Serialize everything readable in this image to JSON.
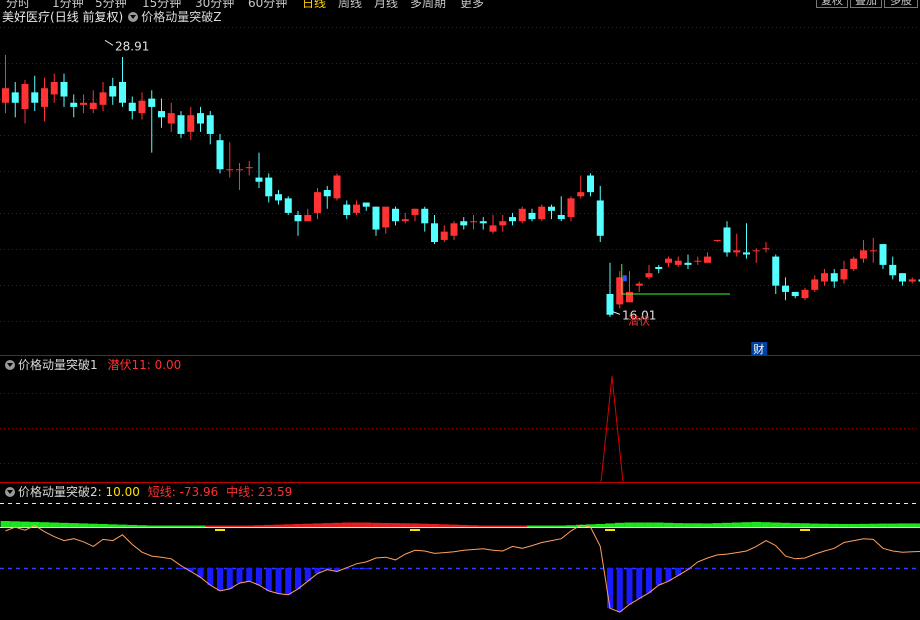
{
  "toolbar": {
    "periods": [
      "分时",
      "1分钟",
      "5分钟",
      "15分钟",
      "30分钟",
      "60分钟",
      "日线",
      "周线",
      "月线",
      "多周期",
      "更多"
    ],
    "active_period": "日线",
    "buttons": [
      "复权",
      "叠加",
      "多股"
    ]
  },
  "main_panel": {
    "symbol": "美好医疗",
    "mode": "(日线 前复权)",
    "indicator": "价格动量突破Z",
    "high_label": "28.91",
    "low_label": "16.01",
    "low_annotation": "潜伏",
    "fin_marker": "财"
  },
  "panel2": {
    "indicator": "价格动量突破1",
    "value_label": "潜伏11: 0.00"
  },
  "panel3": {
    "indicator": "价格动量突破2",
    "value_label": ": 10.00",
    "short_label": "短线: -73.96",
    "mid_label": "中线: 23.59"
  },
  "colors": {
    "up": "#ff3333",
    "down": "#54ffff",
    "grid": "#8b0000",
    "line_green": "#33ff33",
    "ma_orange": "#ffa060",
    "spike_red": "#dd0000",
    "bar_blue": "#1a1aff"
  },
  "chart_data": [
    {
      "type": "candlestick",
      "candles": [
        [
          26.0,
          26.7,
          25.5,
          28.3
        ],
        [
          26.5,
          26.0,
          25.3,
          27.0
        ],
        [
          25.7,
          26.9,
          25.0,
          27.1
        ],
        [
          26.5,
          26.0,
          25.6,
          27.3
        ],
        [
          25.8,
          26.7,
          25.1,
          27.2
        ],
        [
          26.4,
          27.0,
          26.0,
          27.4
        ],
        [
          27.0,
          26.3,
          25.8,
          27.4
        ],
        [
          26.0,
          25.8,
          25.3,
          26.4
        ],
        [
          25.9,
          26.0,
          25.5,
          26.4
        ],
        [
          25.7,
          26.0,
          25.5,
          26.6
        ],
        [
          25.9,
          26.5,
          25.6,
          27.0
        ],
        [
          26.8,
          26.3,
          25.9,
          27.2
        ],
        [
          27.0,
          26.0,
          25.8,
          28.2
        ],
        [
          26.0,
          25.6,
          25.2,
          26.3
        ],
        [
          25.5,
          26.1,
          25.2,
          26.5
        ],
        [
          26.2,
          25.8,
          23.6,
          26.6
        ],
        [
          25.6,
          25.3,
          24.8,
          26.2
        ],
        [
          25.0,
          25.5,
          24.6,
          26.0
        ],
        [
          25.4,
          24.5,
          24.3,
          25.6
        ],
        [
          24.6,
          25.4,
          24.2,
          25.8
        ],
        [
          25.5,
          25.0,
          24.6,
          25.8
        ],
        [
          25.4,
          24.5,
          24.0,
          25.6
        ],
        [
          24.2,
          22.8,
          22.6,
          24.5
        ],
        [
          22.8,
          22.8,
          22.4,
          24.1
        ],
        [
          22.8,
          22.8,
          21.8,
          23.1
        ],
        [
          22.9,
          22.9,
          22.5,
          23.2
        ],
        [
          22.4,
          22.2,
          21.9,
          23.6
        ],
        [
          22.4,
          21.5,
          21.2,
          22.6
        ],
        [
          21.6,
          21.3,
          21.1,
          21.8
        ],
        [
          21.4,
          20.7,
          20.6,
          21.5
        ],
        [
          20.6,
          20.3,
          19.6,
          20.8
        ],
        [
          20.3,
          20.6,
          20.3,
          20.9
        ],
        [
          20.7,
          21.7,
          20.4,
          21.9
        ],
        [
          21.8,
          21.5,
          20.9,
          22.0
        ],
        [
          21.4,
          22.5,
          21.3,
          22.6
        ],
        [
          21.1,
          20.6,
          20.4,
          21.3
        ],
        [
          20.7,
          21.1,
          20.6,
          21.3
        ],
        [
          21.2,
          21.0,
          20.8,
          21.2
        ],
        [
          21.0,
          19.9,
          19.6,
          21.0
        ],
        [
          20.0,
          21.0,
          19.7,
          21.0
        ],
        [
          20.9,
          20.3,
          20.1,
          21.0
        ],
        [
          20.3,
          20.4,
          20.2,
          20.7
        ],
        [
          20.6,
          20.9,
          20.3,
          20.9
        ],
        [
          20.9,
          20.2,
          19.8,
          21.0
        ],
        [
          20.2,
          19.3,
          19.2,
          20.6
        ],
        [
          19.4,
          19.8,
          19.3,
          20.1
        ],
        [
          19.6,
          20.2,
          19.4,
          20.3
        ],
        [
          20.3,
          20.1,
          19.9,
          20.5
        ],
        [
          20.3,
          20.3,
          19.9,
          20.6
        ],
        [
          20.3,
          20.2,
          19.9,
          20.5
        ],
        [
          19.8,
          20.1,
          19.7,
          20.6
        ],
        [
          20.1,
          20.3,
          19.8,
          20.6
        ],
        [
          20.5,
          20.3,
          20.1,
          20.7
        ],
        [
          20.3,
          20.9,
          20.2,
          21.0
        ],
        [
          20.7,
          20.4,
          20.3,
          20.9
        ],
        [
          20.4,
          21.0,
          20.3,
          21.1
        ],
        [
          21.0,
          20.8,
          20.4,
          21.1
        ],
        [
          20.6,
          20.4,
          20.3,
          21.5
        ],
        [
          20.5,
          21.4,
          20.3,
          21.5
        ],
        [
          21.5,
          21.7,
          21.4,
          22.5
        ],
        [
          22.5,
          21.7,
          21.5,
          22.6
        ],
        [
          21.3,
          19.6,
          19.3,
          22.0
        ],
        [
          16.8,
          15.8,
          15.7,
          18.3
        ],
        [
          16.3,
          17.6,
          16.1,
          17.9
        ],
        [
          16.4,
          16.9,
          16.5,
          17.9
        ],
        [
          17.2,
          17.3,
          16.9,
          17.4
        ],
        [
          17.6,
          17.8,
          17.5,
          18.2
        ],
        [
          18.1,
          18.0,
          17.8,
          18.2
        ],
        [
          18.3,
          18.5,
          18.1,
          18.6
        ],
        [
          18.2,
          18.4,
          18.1,
          18.6
        ],
        [
          18.3,
          18.2,
          18.0,
          18.7
        ],
        [
          18.4,
          18.4,
          18.2,
          18.6
        ],
        [
          18.3,
          18.6,
          18.3,
          18.8
        ],
        [
          19.4,
          19.4,
          19.3,
          19.4
        ],
        [
          20.0,
          18.8,
          18.6,
          20.3
        ],
        [
          18.8,
          18.9,
          18.6,
          19.7
        ],
        [
          18.8,
          18.7,
          18.5,
          20.2
        ],
        [
          18.9,
          18.9,
          18.3,
          19.0
        ],
        [
          19.0,
          19.0,
          18.8,
          19.3
        ],
        [
          18.6,
          17.2,
          16.8,
          18.7
        ],
        [
          17.2,
          16.9,
          16.5,
          17.6
        ],
        [
          16.9,
          16.7,
          16.6,
          16.9
        ],
        [
          16.6,
          17.0,
          16.5,
          17.1
        ],
        [
          17.0,
          17.5,
          16.9,
          17.7
        ],
        [
          17.4,
          17.8,
          17.2,
          18.0
        ],
        [
          17.8,
          17.4,
          17.1,
          18.0
        ],
        [
          17.5,
          18.0,
          17.3,
          18.4
        ],
        [
          18.0,
          18.5,
          17.9,
          18.6
        ],
        [
          18.5,
          18.9,
          18.3,
          19.4
        ],
        [
          18.9,
          18.9,
          18.3,
          19.5
        ],
        [
          19.2,
          18.2,
          18.0,
          19.2
        ],
        [
          18.2,
          17.7,
          17.5,
          18.6
        ],
        [
          17.8,
          17.4,
          17.2,
          17.8
        ],
        [
          17.4,
          17.5,
          17.3,
          17.6
        ],
        [
          17.5,
          17.4,
          17.2,
          17.6
        ],
        [
          17.4,
          17.5,
          17.3,
          17.7
        ]
      ],
      "y_range": [
        15.5,
        29.5
      ],
      "high_marker": 28.91,
      "low_marker": 16.01,
      "support_line": 16.8,
      "grid": true
    },
    {
      "type": "line",
      "series": [
        {
          "name": "潜伏11",
          "spike_index": 62,
          "spike_value": 1,
          "baseline": 0
        }
      ],
      "y_range": [
        0,
        1.1
      ],
      "grid": true
    },
    {
      "type": "bar",
      "series": [
        {
          "name": "短线",
          "values": [
            -20,
            -10,
            -18,
            -6,
            -22,
            -35,
            -45,
            -40,
            -48,
            -60,
            -42,
            -45,
            -30,
            -55,
            -75,
            -85,
            -88,
            -92,
            -110,
            -125,
            -140,
            -160,
            -175,
            -170,
            -155,
            -150,
            -160,
            -175,
            -182,
            -185,
            -170,
            -150,
            -130,
            -120,
            -125,
            -115,
            -105,
            -100,
            -90,
            -88,
            -95,
            -80,
            -70,
            -72,
            -78,
            -76,
            -74,
            -70,
            -68,
            -66,
            -70,
            -72,
            -60,
            -65,
            -58,
            -50,
            -45,
            -40,
            -20,
            -5,
            -10,
            -60,
            -220,
            -230,
            -210,
            -195,
            -180,
            -160,
            -150,
            -135,
            -120,
            -100,
            -90,
            -82,
            -80,
            -76,
            -72,
            -60,
            -45,
            -58,
            -85,
            -92,
            -90,
            -80,
            -72,
            -65,
            -50,
            -45,
            -40,
            -42,
            -65,
            -72,
            -75,
            -74,
            -73,
            -74
          ]
        },
        {
          "name": "中线",
          "values": [
            40,
            38,
            36,
            34,
            32,
            30,
            28,
            26,
            24,
            22,
            20,
            18,
            16,
            14,
            12,
            10,
            8,
            6,
            4,
            2,
            0,
            -2,
            -4,
            -6,
            -8,
            -10,
            -12,
            -14,
            -16,
            -18,
            -20,
            -22,
            -24,
            -26,
            -28,
            -30,
            -30,
            -30,
            -28,
            -27,
            -26,
            -25,
            -24,
            -22,
            -20,
            -18,
            -16,
            -14,
            -12,
            -10,
            -8,
            -6,
            -4,
            -2,
            0,
            3,
            6,
            9,
            12,
            15,
            18,
            20,
            24,
            28,
            30,
            30,
            30,
            30,
            28,
            26,
            25,
            25,
            24,
            26,
            28,
            30,
            32,
            34,
            32,
            30,
            28,
            26,
            25,
            23,
            22,
            21,
            20,
            20,
            21,
            22,
            23,
            23,
            24,
            24,
            24,
            23.59
          ]
        }
      ],
      "reference_lines": [
        10,
        -73.96
      ],
      "y_range": [
        -240,
        60
      ]
    }
  ]
}
